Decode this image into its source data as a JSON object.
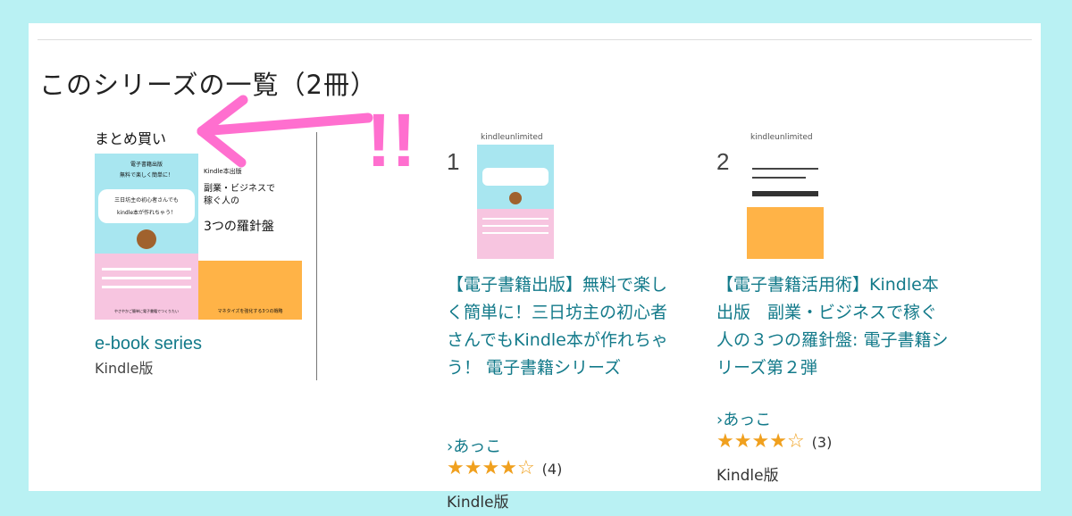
{
  "series": {
    "title": "このシリーズの一覧（2冊）"
  },
  "bundle": {
    "label": "まとめ買い",
    "cover1": {
      "lines": [
        "電子書籍出版",
        "無料で楽しく簡単に！",
        "三日坊主の初心者さんでも",
        "kindle本が作れちゃう！",
        "やさやかご簡単に電子書籍でつくりたい"
      ]
    },
    "cover2": {
      "lines": [
        "Kindle本出版",
        "副業・ビジネスで",
        "稼ぐ人の",
        "3つの羅針盤",
        "マネタイズを強化する3つの戦略"
      ]
    },
    "link": "e-book series",
    "format": "Kindle版"
  },
  "annotation": {
    "marks": "!!",
    "color": "#ff6fcf"
  },
  "items": [
    {
      "number": "1",
      "badge": "kindleunlimited",
      "title": "【電子書籍出版】無料で楽しく簡単に！三日坊主の初心者さんでもKindle本が作れちゃう！ 電子書籍シリーズ",
      "author": "›あっこ",
      "rating": 4,
      "rating_count": "(4)",
      "format": "Kindle版"
    },
    {
      "number": "2",
      "badge": "kindleunlimited",
      "title": "【電子書籍活用術】Kindle本出版　副業・ビジネスで稼ぐ人の３つの羅針盤: 電子書籍シリーズ第２弾",
      "author": "›あっこ",
      "rating": 4,
      "rating_count": "(3)",
      "format": "Kindle版"
    }
  ],
  "colors": {
    "background": "#b9f1f3",
    "link": "#137a8a",
    "star": "#f0a01e",
    "cover_blue": "#a8e6f0",
    "cover_pink": "#f7c5e0",
    "cover_orange": "#ffb347"
  }
}
